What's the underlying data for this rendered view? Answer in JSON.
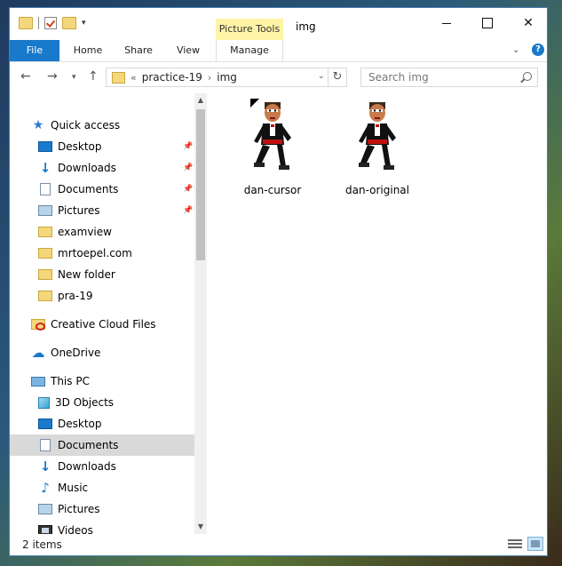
{
  "window": {
    "title": "img",
    "context_tab_group": "Picture Tools"
  },
  "ribbon": {
    "tabs": [
      "File",
      "Home",
      "Share",
      "View",
      "Manage"
    ],
    "help_label": "?"
  },
  "address": {
    "overflow": "«",
    "crumbs": [
      "practice-19",
      "img"
    ]
  },
  "search": {
    "placeholder": "Search img"
  },
  "nav": {
    "quick_access": "Quick access",
    "quick_items": [
      {
        "label": "Desktop",
        "icon": "desktop-icon",
        "pinned": true
      },
      {
        "label": "Downloads",
        "icon": "downloads-icon",
        "pinned": true
      },
      {
        "label": "Documents",
        "icon": "documents-icon",
        "pinned": true
      },
      {
        "label": "Pictures",
        "icon": "pictures-icon",
        "pinned": true
      },
      {
        "label": "examview",
        "icon": "folder-icon"
      },
      {
        "label": "mrtoepel.com",
        "icon": "folder-icon"
      },
      {
        "label": "New folder",
        "icon": "folder-icon"
      },
      {
        "label": "pra-19",
        "icon": "folder-icon"
      }
    ],
    "creative_cloud": "Creative Cloud Files",
    "onedrive": "OneDrive",
    "this_pc": "This PC",
    "pc_items": [
      {
        "label": "3D Objects",
        "icon": "3d-objects-icon"
      },
      {
        "label": "Desktop",
        "icon": "desktop-icon"
      },
      {
        "label": "Documents",
        "icon": "documents-icon",
        "selected": true
      },
      {
        "label": "Downloads",
        "icon": "downloads-icon"
      },
      {
        "label": "Music",
        "icon": "music-icon"
      },
      {
        "label": "Pictures",
        "icon": "pictures-icon"
      },
      {
        "label": "Videos",
        "icon": "videos-icon"
      }
    ]
  },
  "files": [
    {
      "name": "dan-cursor"
    },
    {
      "name": "dan-original"
    }
  ],
  "status": {
    "count": "2 items"
  }
}
